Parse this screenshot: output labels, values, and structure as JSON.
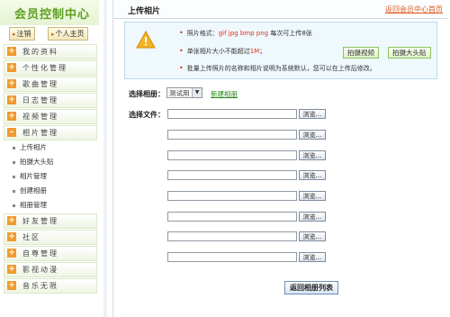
{
  "sidebar": {
    "title": "会员控制中心",
    "logout_label": "注销",
    "homepage_label": "个人主页",
    "items": [
      {
        "label": "我的资料"
      },
      {
        "label": "个性化管理"
      },
      {
        "label": "歌曲管理"
      },
      {
        "label": "日志管理"
      },
      {
        "label": "视频管理"
      },
      {
        "label": "相片管理"
      }
    ],
    "sub_items": [
      {
        "label": "上传相片"
      },
      {
        "label": "拍摄大头贴"
      },
      {
        "label": "相片管理"
      },
      {
        "label": "创建相册"
      },
      {
        "label": "相册管理"
      }
    ],
    "items_after": [
      {
        "label": "好友管理"
      },
      {
        "label": "社区"
      },
      {
        "label": "自尊管理"
      },
      {
        "label": "影视动漫"
      },
      {
        "label": "音乐无限"
      }
    ]
  },
  "main": {
    "title": "上传相片",
    "return_link": "返回会员中心首页",
    "notice": {
      "line1_prefix": "照片格式：",
      "line1_formats": "gif jpg bmp png",
      "line1_suffix": " 每次可上传8张",
      "line2_prefix": "单张相片大小不能超过",
      "line2_limit": "1M",
      "line2_suffix": "；",
      "line3": "批量上传照片的名称和相片说明为系统默认，您可以在上传后修改。",
      "video_button": "拍摄视频",
      "avatar_button": "拍摄大头贴"
    },
    "album_label": "选择相册：",
    "album_selected": "测试用",
    "new_album_link": "新建相册",
    "file_label": "选择文件：",
    "browse_label": "浏览...",
    "file_count": 8,
    "back_button": "返回相册列表"
  },
  "colors": {
    "accent_green": "#5ea021",
    "link_orange": "#e05a1e",
    "plus_orange": "#f19a2e"
  }
}
